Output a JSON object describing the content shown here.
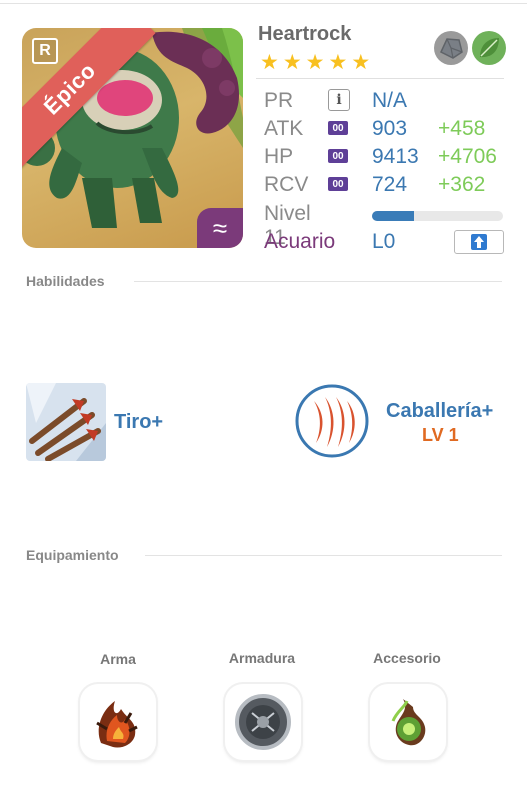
{
  "hero": {
    "name": "Heartrock",
    "rarity": "Épico",
    "stars": 5,
    "badge": "R",
    "class_icon": "waves-icon",
    "elements": [
      "stone-element-icon",
      "leaf-element-icon"
    ]
  },
  "stats": {
    "pr": {
      "label": "PR",
      "value": "N/A"
    },
    "atk": {
      "label": "ATK",
      "tag": "00",
      "value": "903",
      "bonus": "+458"
    },
    "hp": {
      "label": "HP",
      "tag": "00",
      "value": "9413",
      "bonus": "+4706"
    },
    "rcv": {
      "label": "RCV",
      "tag": "00",
      "value": "724",
      "bonus": "+362"
    },
    "level": {
      "label": "Nivel 11",
      "progress": 0.32
    },
    "sign": {
      "label": "Acuario",
      "value": "L0"
    }
  },
  "skills": {
    "title": "Habilidades",
    "active": {
      "name": "Tiro+"
    },
    "passive": {
      "name": "Caballería+",
      "level": "LV 1"
    }
  },
  "equipment": {
    "title": "Equipamiento",
    "slots": [
      {
        "label": "Arma"
      },
      {
        "label": "Armadura"
      },
      {
        "label": "Accesorio"
      }
    ]
  },
  "colors": {
    "accent_blue": "#3b78b1",
    "bonus_green": "#7ecb59",
    "rarity_red": "#e0605a",
    "class_purple": "#7b3a7a",
    "star_yellow": "#f8c020",
    "level_orange": "#e06a22"
  }
}
